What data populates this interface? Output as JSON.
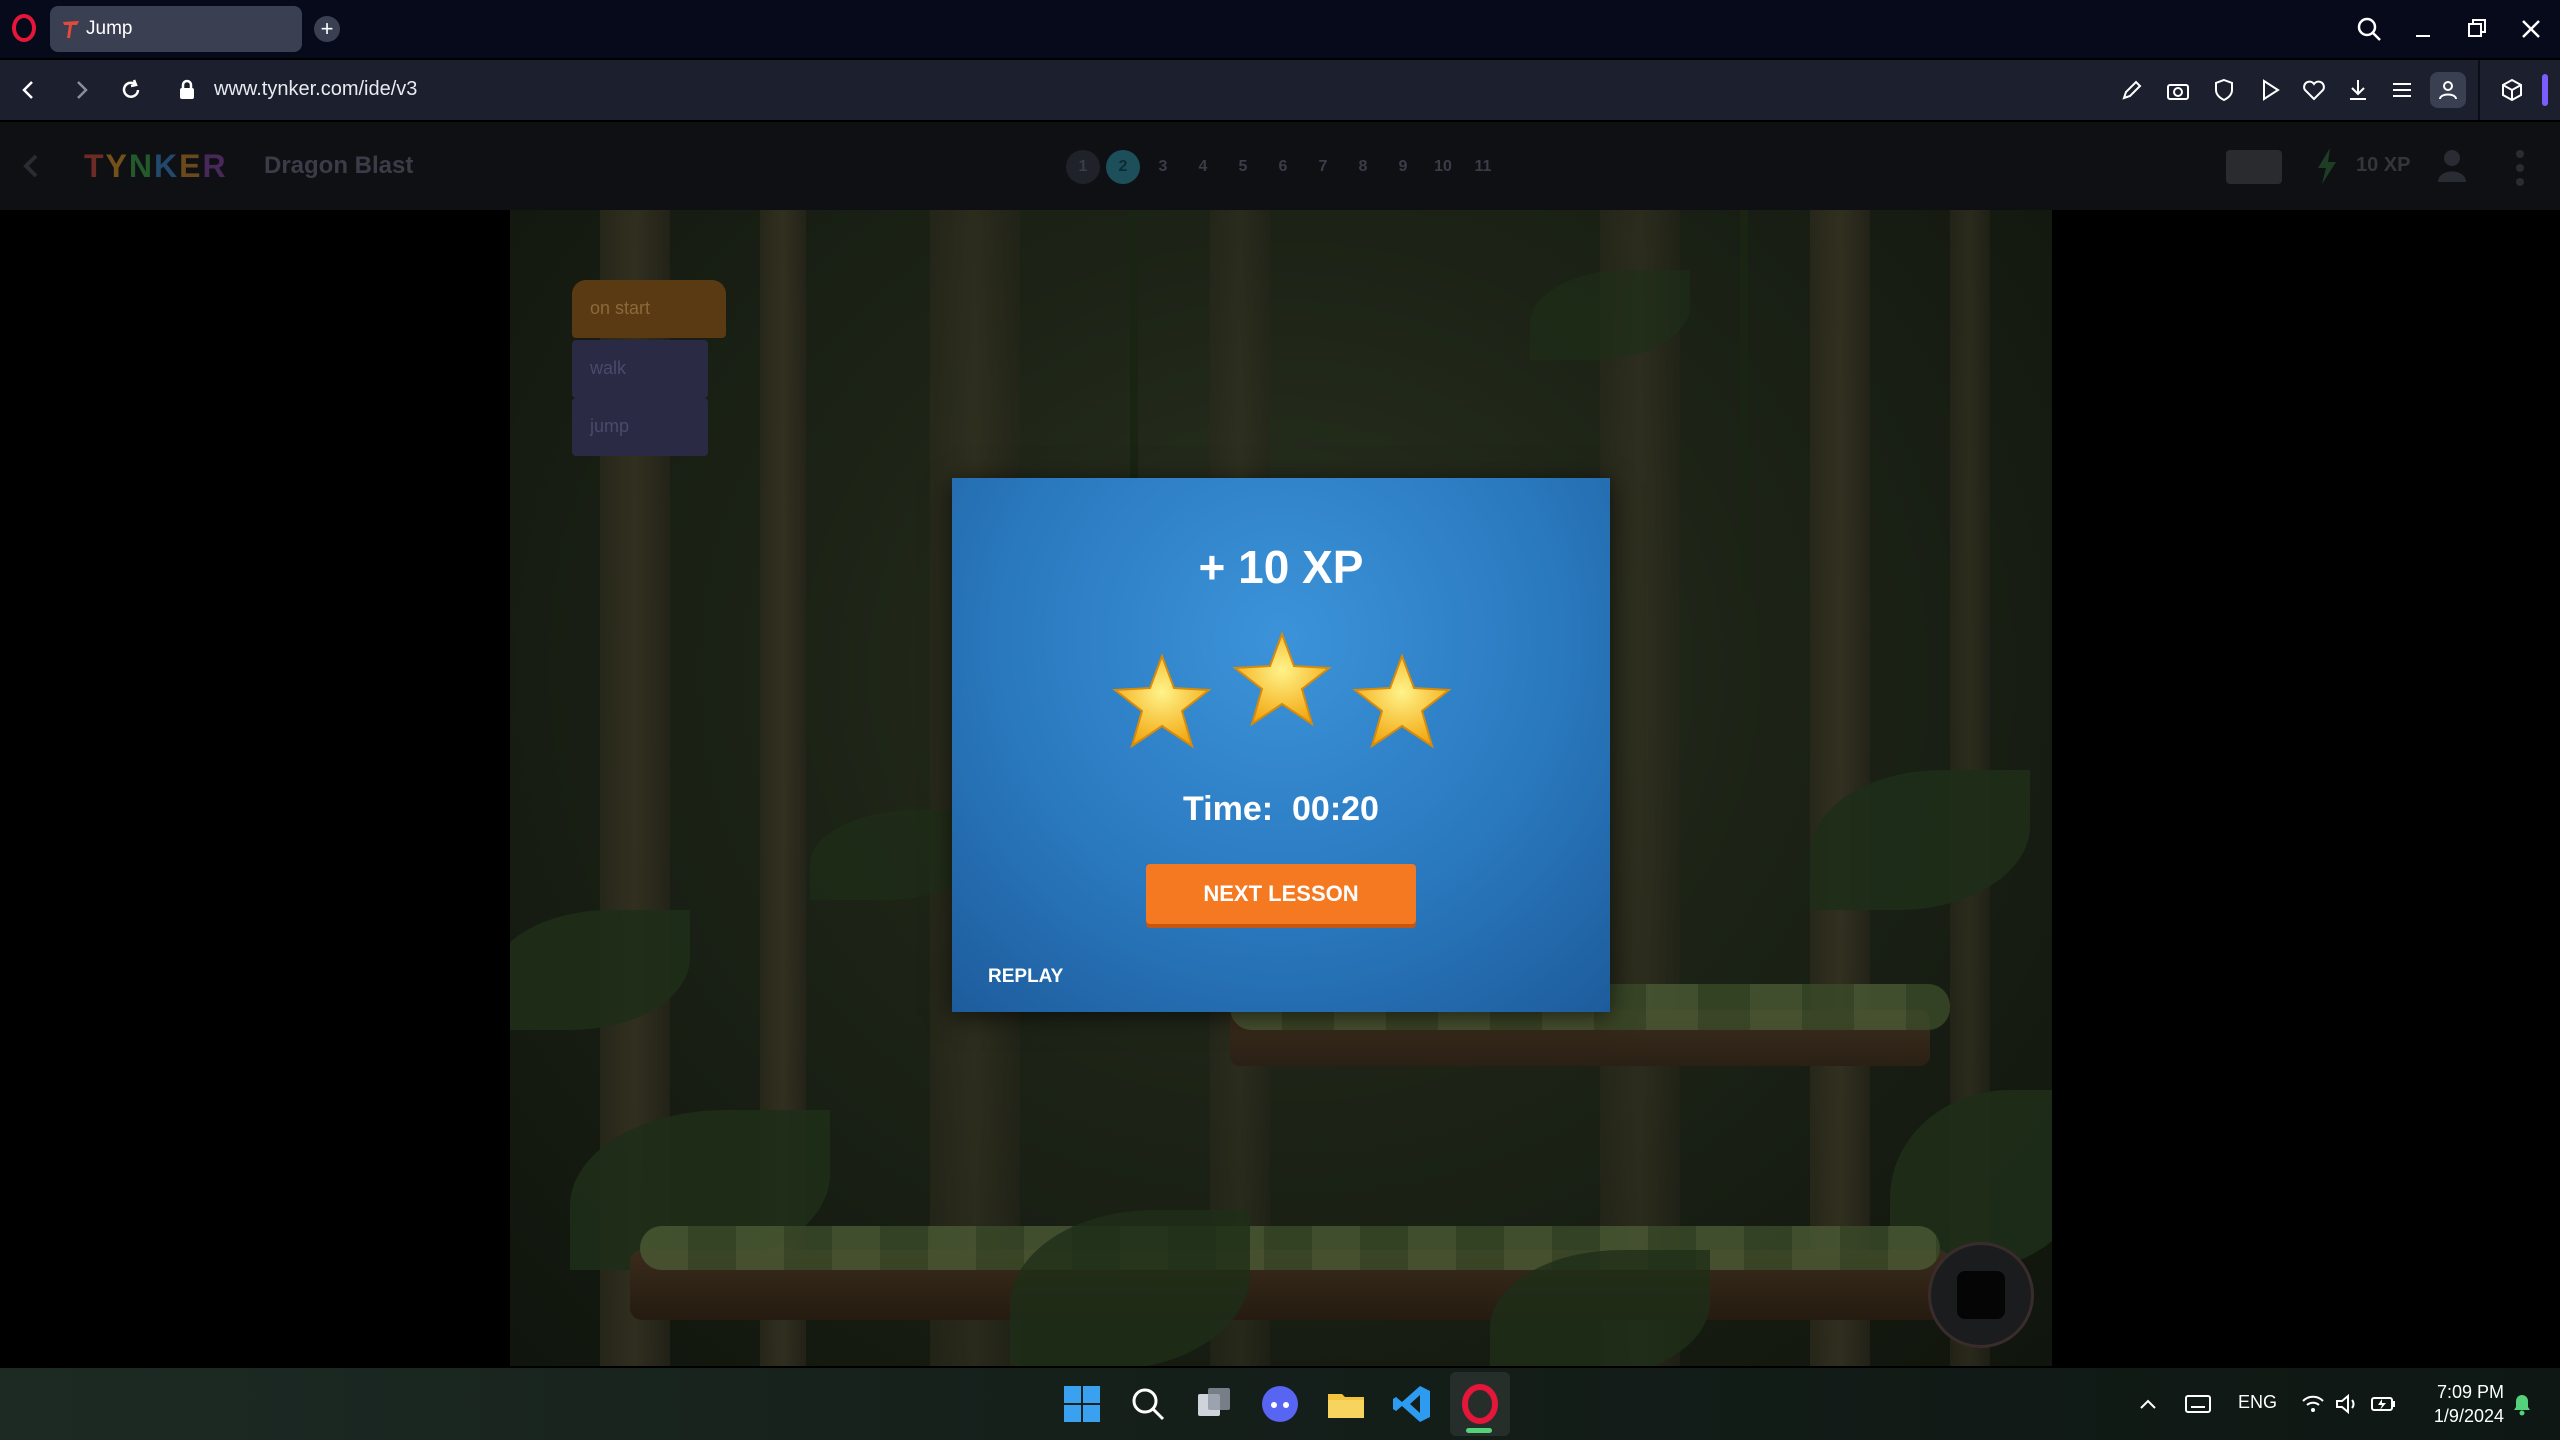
{
  "browser": {
    "tab_title": "Jump",
    "url": "www.tynker.com/ide/v3"
  },
  "header": {
    "lesson_title": "Dragon Blast",
    "steps": [
      "1",
      "2",
      "3",
      "4",
      "5",
      "6",
      "7",
      "8",
      "9",
      "10",
      "11"
    ],
    "current_step": 2,
    "xp": "10 XP"
  },
  "code_blocks": {
    "start": "on start",
    "walk": "walk",
    "jump": "jump"
  },
  "modal": {
    "xp_gain": "+ 10 XP",
    "stars_earned": 3,
    "stars_total": 3,
    "time_label": "Time:",
    "time_value": "00:20",
    "next_label": "NEXT LESSON",
    "replay_label": "REPLAY"
  },
  "taskbar": {
    "language": "ENG",
    "time": "7:09 PM",
    "date": "1/9/2024"
  },
  "colors": {
    "modal_blue": "#2a79bf",
    "next_orange": "#f47920",
    "star_gold": "#f7c21b"
  }
}
